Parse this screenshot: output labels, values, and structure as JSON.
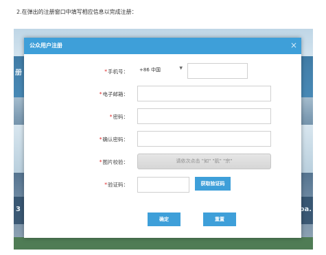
{
  "instruction": "2.在弹出的注册窗口中填写相应信息以完成注册：",
  "dialog": {
    "title": "公众用户注册",
    "close_icon": "×"
  },
  "form": {
    "required_mark": "*",
    "phone": {
      "label": "手机号：",
      "country_value": "+86 中国",
      "value": ""
    },
    "email": {
      "label": "电子邮箱：",
      "value": ""
    },
    "password": {
      "label": "密码：",
      "value": ""
    },
    "confirm_password": {
      "label": "确认密码：",
      "value": ""
    },
    "image_captcha": {
      "label": "图片校验：",
      "prompt": "请依次点击 \"如\" \"肌\" \"宗\""
    },
    "sms_code": {
      "label": "验证码：",
      "value": "",
      "get_code_button": "获取验证码"
    }
  },
  "buttons": {
    "confirm": "确定",
    "reset": "重置"
  },
  "colors": {
    "header": "#3e9fd9",
    "button": "#3e9fd9",
    "required": "#e02b2b"
  },
  "background_page": {
    "left_text": "册",
    "left_text2": "3",
    "right_text": "pa."
  }
}
